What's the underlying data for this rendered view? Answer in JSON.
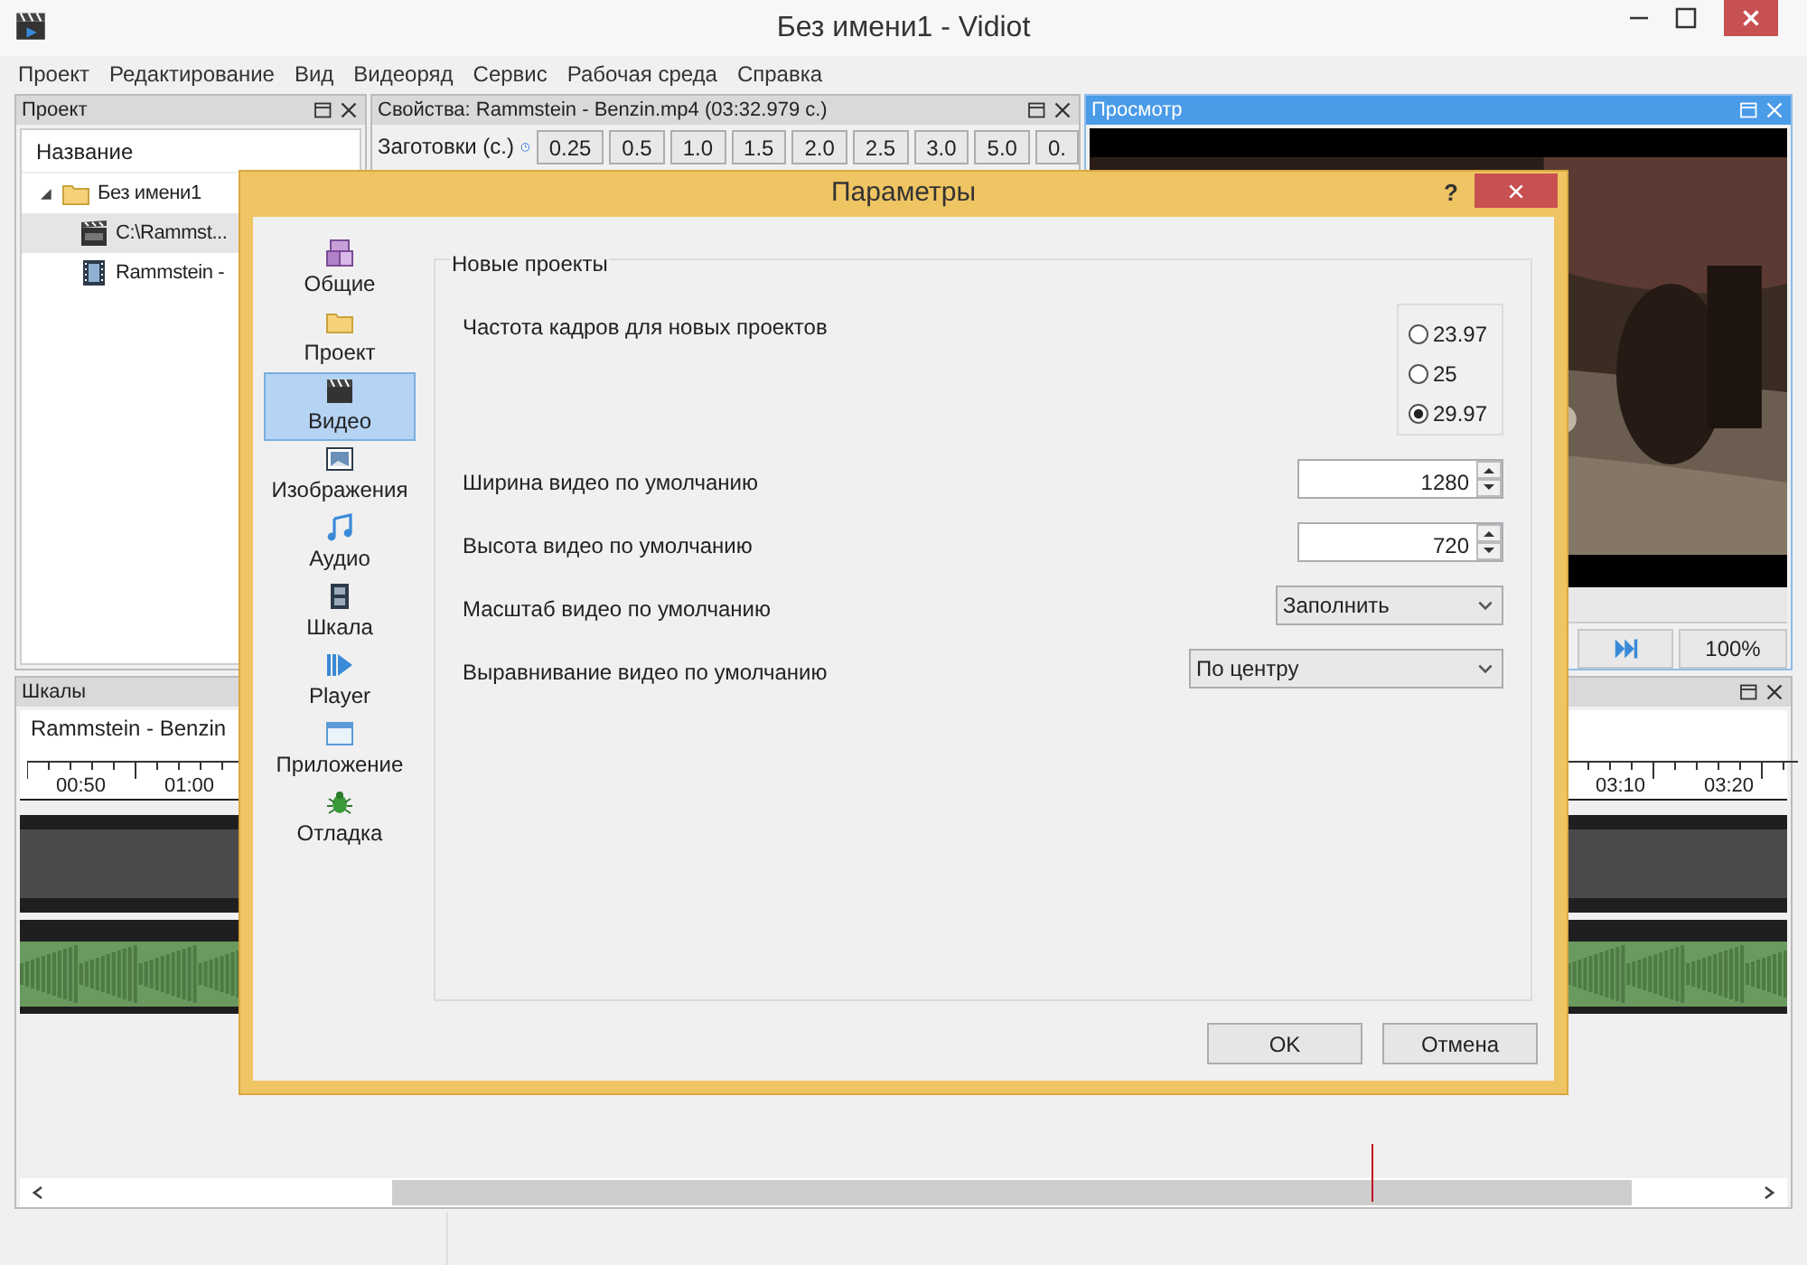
{
  "window": {
    "title": "Без имени1 - Vidiot"
  },
  "menu": [
    "Проект",
    "Редактирование",
    "Вид",
    "Видеоряд",
    "Сервис",
    "Рабочая среда",
    "Справка"
  ],
  "project_panel": {
    "title": "Проект",
    "column": "Название",
    "tree": [
      {
        "label": "Без имени1",
        "kind": "folder",
        "expanded": true,
        "selected": false,
        "children": [
          {
            "label": "C:\\Rammst...",
            "kind": "sequence",
            "selected": true
          },
          {
            "label": "Rammstein -",
            "kind": "file",
            "selected": false
          }
        ]
      }
    ]
  },
  "properties_panel": {
    "title": "Свойства: Rammstein - Benzin.mp4 (03:32.979 с.)",
    "presets_label": "Заготовки (с.)",
    "presets": [
      "0.25",
      "0.5",
      "1.0",
      "1.5",
      "2.0",
      "2.5",
      "3.0",
      "5.0",
      "0."
    ]
  },
  "preview_panel": {
    "title": "Просмотр",
    "zoom": "100%"
  },
  "timelines_panel": {
    "title": "Шкалы",
    "sequence": "Rammstein - Benzin",
    "ticks_left": [
      "00:50",
      "01:00"
    ],
    "ticks_right": [
      "03:10",
      "03:20"
    ]
  },
  "dialog": {
    "title": "Параметры",
    "help": "?",
    "categories": [
      {
        "label": "Общие",
        "kind": "general",
        "selected": false
      },
      {
        "label": "Проект",
        "kind": "project",
        "selected": false
      },
      {
        "label": "Видео",
        "kind": "video",
        "selected": true
      },
      {
        "label": "Изображения",
        "kind": "images",
        "selected": false
      },
      {
        "label": "Аудио",
        "kind": "audio",
        "selected": false
      },
      {
        "label": "Шкала",
        "kind": "timeline",
        "selected": false
      },
      {
        "label": "Player",
        "kind": "player",
        "selected": false
      },
      {
        "label": "Приложение",
        "kind": "application",
        "selected": false
      },
      {
        "label": "Отладка",
        "kind": "debug",
        "selected": false
      }
    ],
    "group": "Новые проекты",
    "settings": [
      {
        "kind": "radio",
        "label": "Частота кадров для новых проектов",
        "options": [
          {
            "label": "23.97",
            "selected": false
          },
          {
            "label": "25",
            "selected": false
          },
          {
            "label": "29.97",
            "selected": true
          }
        ]
      },
      {
        "kind": "spin",
        "label": "Ширина видео по умолчанию",
        "value": "1280"
      },
      {
        "kind": "spin",
        "label": "Высота видео по умолчанию",
        "value": "720"
      },
      {
        "kind": "select",
        "label": "Масштаб видео по умолчанию",
        "value": "Заполнить"
      },
      {
        "kind": "select",
        "label": "Выравнивание видео по умолчанию",
        "value": "По центру"
      }
    ],
    "buttons": [
      "OK",
      "Отмена"
    ]
  }
}
